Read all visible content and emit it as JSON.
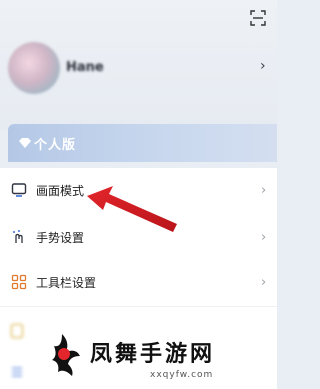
{
  "header": {
    "scan_icon": "scan-icon"
  },
  "profile": {
    "username": "Hane",
    "chevron": "›"
  },
  "vip": {
    "label": "个人版",
    "icon": "diamond-icon",
    "color": "#b4c8e6"
  },
  "menu": {
    "items": [
      {
        "label": "画面模式",
        "icon": "screen-icon",
        "chevron": "›"
      },
      {
        "label": "手势设置",
        "icon": "gesture-icon",
        "chevron": "›"
      },
      {
        "label": "工具栏设置",
        "icon": "toolbar-grid-icon",
        "chevron": "›"
      }
    ],
    "accent_icon_color": "#e07a2e",
    "blue_icon_color": "#3a6fd8"
  },
  "annotation": {
    "arrow_color": "#e3262b"
  },
  "watermark": {
    "brand": "凤舞手游网",
    "url": "xxqyfw.com"
  }
}
